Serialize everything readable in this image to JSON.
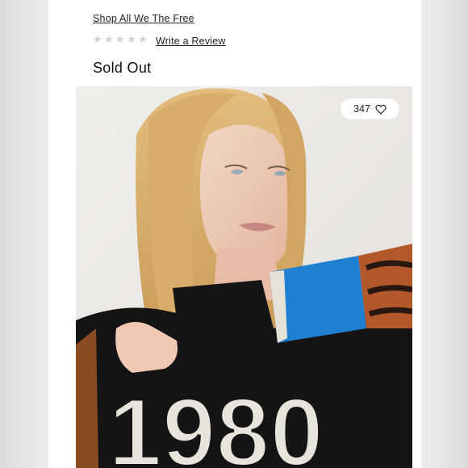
{
  "product": {
    "shop_all_link": "Shop All We The Free",
    "rating": {
      "stars_filled": 0,
      "stars_total": 5,
      "write_review_link": "Write a Review"
    },
    "availability": "Sold Out"
  },
  "image": {
    "likes_count": "347",
    "like_icon": "heart-outline-icon",
    "print_text": "1980"
  },
  "colors": {
    "star_empty": "#d2d2d2",
    "sleeve_blue": "#1f7fd1",
    "shirt_black": "#141414",
    "hair_blonde": "#d9b274"
  }
}
